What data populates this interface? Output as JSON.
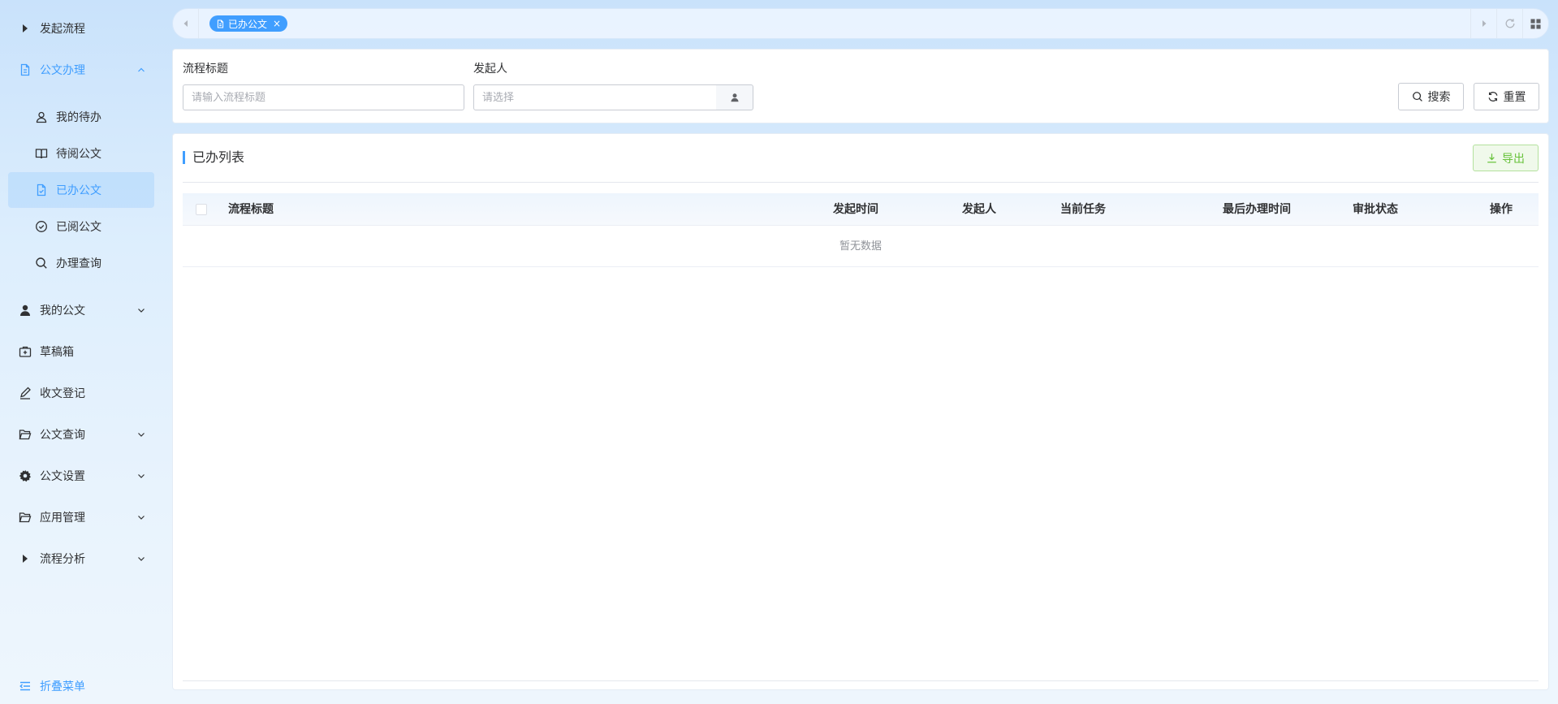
{
  "sidebar": {
    "items": [
      {
        "label": "发起流程",
        "icon": "caret-right-icon"
      },
      {
        "label": "公文办理",
        "icon": "document-icon",
        "expanded": true
      },
      {
        "label": "我的待办",
        "icon": "user-outline-icon"
      },
      {
        "label": "待阅公文",
        "icon": "book-icon"
      },
      {
        "label": "已办公文",
        "icon": "document-check-icon",
        "active": true
      },
      {
        "label": "已阅公文",
        "icon": "circle-check-icon"
      },
      {
        "label": "办理查询",
        "icon": "search-icon"
      },
      {
        "label": "我的公文",
        "icon": "user-filled-icon"
      },
      {
        "label": "草稿箱",
        "icon": "first-aid-kit-icon"
      },
      {
        "label": "收文登记",
        "icon": "edit-pen-icon"
      },
      {
        "label": "公文查询",
        "icon": "folder-opened-icon"
      },
      {
        "label": "公文设置",
        "icon": "setting-icon"
      },
      {
        "label": "应用管理",
        "icon": "folder-opened-icon"
      },
      {
        "label": "流程分析",
        "icon": "caret-right-icon"
      }
    ],
    "collapse_label": "折叠菜单"
  },
  "tabs": {
    "active_tab": "已办公文"
  },
  "search": {
    "title_label": "流程标题",
    "title_placeholder": "请输入流程标题",
    "initiator_label": "发起人",
    "initiator_placeholder": "请选择",
    "search_button": "搜索",
    "reset_button": "重置"
  },
  "table": {
    "title": "已办列表",
    "export_button": "导出",
    "columns": [
      "流程标题",
      "发起时间",
      "发起人",
      "当前任务",
      "最后办理时间",
      "审批状态",
      "操作"
    ],
    "rows": [],
    "empty_text": "暂无数据"
  },
  "colors": {
    "accent": "#409eff",
    "export": "#67c23a"
  }
}
